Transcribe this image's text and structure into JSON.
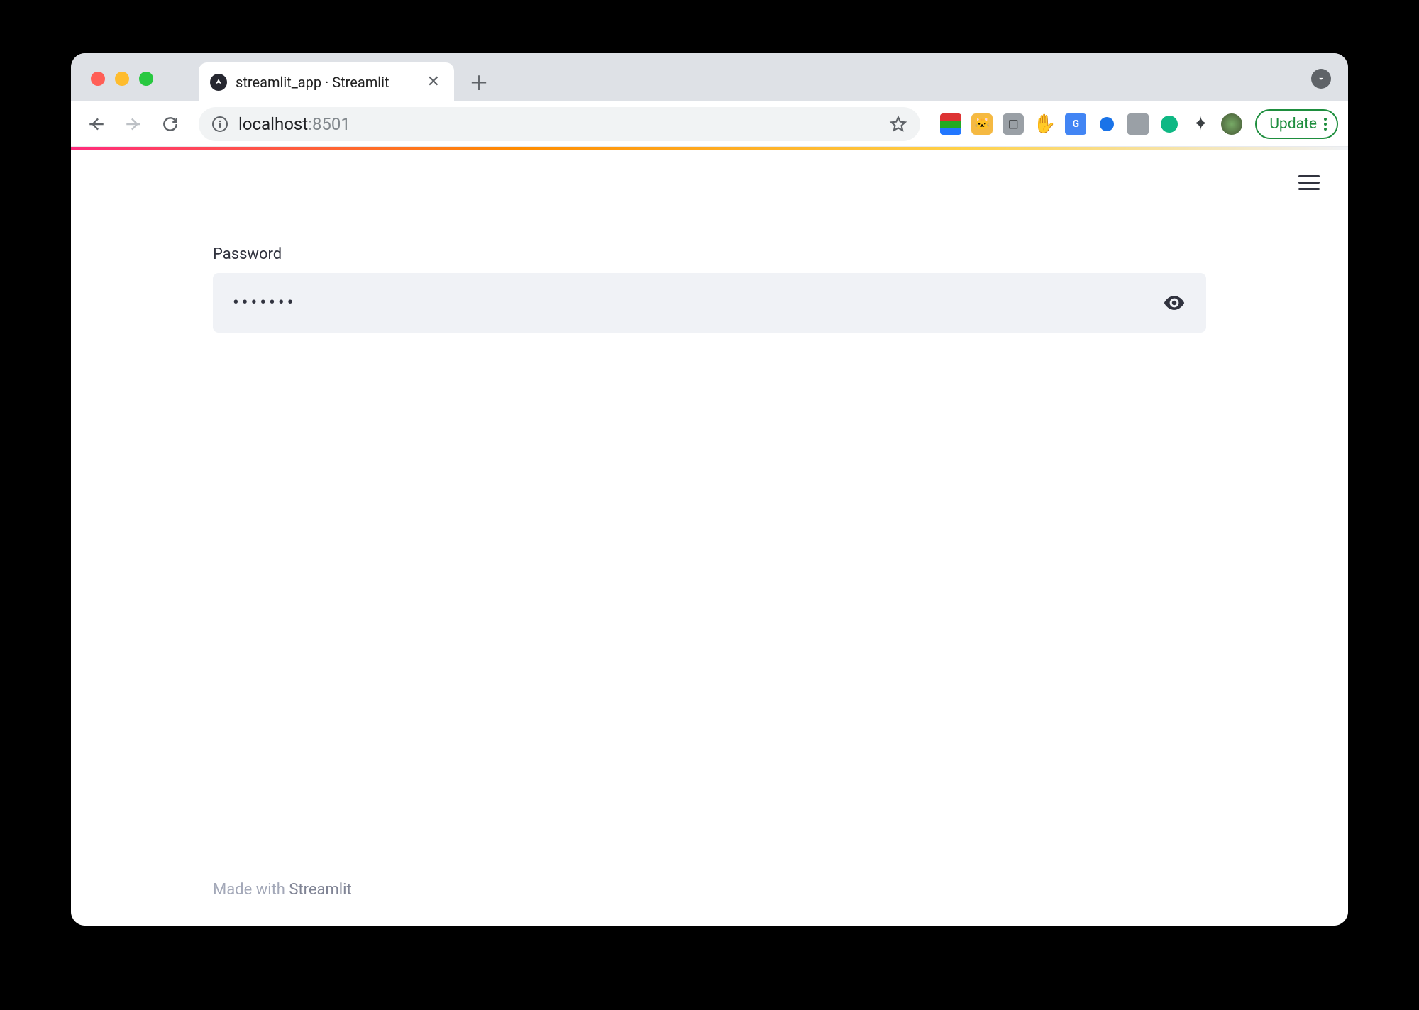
{
  "browser": {
    "tab_title": "streamlit_app · Streamlit",
    "url_host": "localhost",
    "url_port": ":8501",
    "update_label": "Update"
  },
  "app": {
    "field_label": "Password",
    "password_value": "•••••••",
    "footer_prefix": "Made with ",
    "footer_brand": "Streamlit"
  }
}
